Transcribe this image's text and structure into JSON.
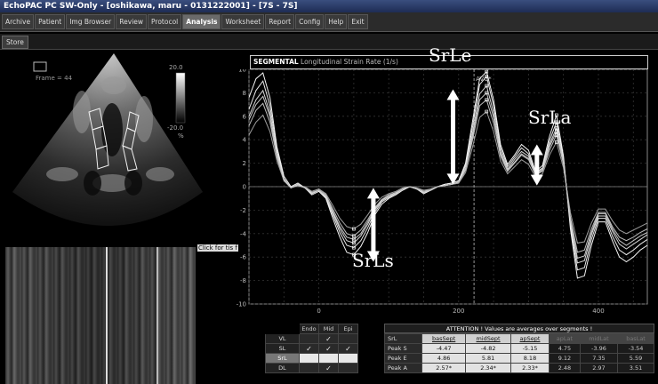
{
  "window": {
    "title": "EchoPAC PC SW-Only - [oshikawa, maru - 0131222001] - [7S - 7S]"
  },
  "menu": {
    "items": [
      {
        "label": "Archive",
        "active": false
      },
      {
        "label": "Patient",
        "active": false
      },
      {
        "label": "Img Browser",
        "active": false
      },
      {
        "label": "Review",
        "active": false
      },
      {
        "label": "Protocol",
        "active": false
      },
      {
        "label": "Analysis",
        "active": true
      },
      {
        "label": "Worksheet",
        "active": false
      },
      {
        "label": "Report",
        "active": false
      },
      {
        "label": "Config",
        "active": false
      },
      {
        "label": "Help",
        "active": false
      },
      {
        "label": "Exit",
        "active": false
      }
    ]
  },
  "toolbar": {
    "store_label": "Store"
  },
  "echo": {
    "frame_label": "Frame = 44",
    "scale_top": "20.0",
    "scale_bottom": "-20.0",
    "scale_unit": "%"
  },
  "mmode": {
    "click_label": "Click for tis f"
  },
  "chart_header": {
    "title_main": "SEGMENTAL",
    "title_sub": " Longitudinal Strain Rate (1/s)"
  },
  "annotations": {
    "srle": "SrLe",
    "srls": "SrLs",
    "srla": "SrLa",
    "avc": "AVC*"
  },
  "chart_data": {
    "type": "line",
    "title": "Longitudinal Strain Rate (1/s)",
    "xlabel": "",
    "ylabel": "",
    "xlim": [
      -100,
      470
    ],
    "ylim": [
      -10,
      10
    ],
    "xticks": [
      0,
      200,
      400
    ],
    "yticks": [
      10,
      8,
      6,
      4,
      2,
      0,
      -2,
      -4,
      -6,
      -8,
      -10
    ],
    "avc_x": 222,
    "grid": true,
    "x": [
      -100,
      -90,
      -80,
      -70,
      -60,
      -50,
      -40,
      -30,
      -20,
      -10,
      0,
      10,
      20,
      30,
      40,
      50,
      60,
      70,
      80,
      90,
      100,
      110,
      120,
      130,
      140,
      150,
      160,
      170,
      180,
      190,
      200,
      210,
      220,
      230,
      240,
      250,
      260,
      270,
      280,
      290,
      300,
      310,
      320,
      330,
      340,
      350,
      360,
      370,
      380,
      390,
      400,
      410,
      420,
      430,
      440,
      450,
      460,
      470
    ],
    "series": [
      {
        "values": [
          6.6,
          8.2,
          9.0,
          6.9,
          3.1,
          0.7,
          -0.1,
          0.2,
          -0.1,
          -0.6,
          -0.3,
          -0.9,
          -2.4,
          -3.9,
          -5.0,
          -5.2,
          -4.6,
          -3.5,
          -2.2,
          -1.3,
          -0.9,
          -0.6,
          -0.2,
          0.0,
          -0.2,
          -0.5,
          -0.3,
          0.0,
          0.2,
          0.3,
          0.5,
          1.8,
          5.1,
          8.7,
          9.4,
          6.9,
          3.3,
          1.7,
          2.5,
          3.3,
          2.8,
          1.2,
          1.6,
          3.9,
          5.5,
          2.4,
          -3.3,
          -7.1,
          -6.9,
          -4.5,
          -2.7,
          -2.7,
          -4.2,
          -5.4,
          -5.8,
          -5.4,
          -4.9,
          -4.5
        ]
      },
      {
        "values": [
          5.2,
          6.5,
          7.1,
          5.5,
          2.5,
          0.5,
          -0.1,
          0.1,
          -0.1,
          -0.4,
          -0.2,
          -0.7,
          -1.9,
          -3.1,
          -4.0,
          -4.2,
          -3.7,
          -2.8,
          -1.8,
          -1.1,
          -0.7,
          -0.5,
          -0.2,
          0.0,
          -0.1,
          -0.4,
          -0.2,
          0.0,
          0.1,
          0.2,
          0.3,
          1.4,
          4.0,
          6.9,
          7.4,
          5.4,
          2.6,
          1.3,
          2.0,
          2.7,
          2.3,
          1.0,
          1.3,
          3.1,
          4.4,
          1.9,
          -2.6,
          -5.6,
          -5.4,
          -3.6,
          -2.2,
          -2.2,
          -3.4,
          -4.3,
          -4.6,
          -4.3,
          -3.9,
          -3.6
        ]
      },
      {
        "values": [
          7.6,
          9.2,
          9.7,
          7.6,
          3.4,
          0.9,
          0.0,
          0.3,
          -0.1,
          -0.7,
          -0.4,
          -1.0,
          -2.7,
          -4.3,
          -5.6,
          -5.8,
          -5.1,
          -3.9,
          -2.4,
          -1.5,
          -1.0,
          -0.7,
          -0.3,
          0.0,
          -0.2,
          -0.6,
          -0.3,
          0.0,
          0.2,
          0.3,
          0.5,
          2.0,
          5.6,
          9.2,
          9.8,
          7.4,
          3.6,
          1.9,
          2.7,
          3.6,
          3.1,
          1.3,
          1.8,
          4.3,
          6.1,
          2.6,
          -3.6,
          -7.8,
          -7.6,
          -5.0,
          -3.0,
          -3.0,
          -4.6,
          -6.0,
          -6.4,
          -6.0,
          -5.4,
          -5.0
        ]
      },
      {
        "values": [
          4.4,
          5.5,
          6.1,
          4.7,
          2.2,
          0.5,
          -0.1,
          0.1,
          0.0,
          -0.4,
          -0.2,
          -0.6,
          -1.6,
          -2.7,
          -3.4,
          -3.6,
          -3.2,
          -2.4,
          -1.5,
          -0.9,
          -0.6,
          -0.4,
          -0.1,
          0.0,
          -0.1,
          -0.3,
          -0.2,
          0.0,
          0.1,
          0.2,
          0.3,
          1.2,
          3.4,
          5.9,
          6.4,
          4.7,
          2.2,
          1.1,
          1.7,
          2.3,
          1.9,
          0.8,
          1.1,
          2.7,
          3.8,
          1.6,
          -2.2,
          -4.8,
          -4.7,
          -3.1,
          -1.9,
          -1.9,
          -2.9,
          -3.7,
          -4.0,
          -3.7,
          -3.4,
          -3.1
        ]
      },
      {
        "values": [
          6.0,
          7.4,
          8.2,
          6.3,
          2.8,
          0.6,
          -0.1,
          0.2,
          -0.1,
          -0.5,
          -0.3,
          -0.8,
          -2.2,
          -3.6,
          -4.6,
          -4.8,
          -4.2,
          -3.2,
          -2.0,
          -1.2,
          -0.8,
          -0.6,
          -0.2,
          0.0,
          -0.2,
          -0.5,
          -0.3,
          0.0,
          0.1,
          0.2,
          0.4,
          1.6,
          4.6,
          7.9,
          8.6,
          6.3,
          3.0,
          1.5,
          2.3,
          3.0,
          2.6,
          1.1,
          1.5,
          3.6,
          5.0,
          2.2,
          -3.0,
          -6.5,
          -6.3,
          -4.1,
          -2.5,
          -2.5,
          -3.8,
          -4.9,
          -5.3,
          -4.9,
          -4.5,
          -4.1
        ]
      },
      {
        "values": [
          5.7,
          7.0,
          7.7,
          6.0,
          2.6,
          0.6,
          -0.1,
          0.1,
          -0.1,
          -0.5,
          -0.3,
          -0.8,
          -2.1,
          -3.4,
          -4.3,
          -4.5,
          -4.0,
          -3.0,
          -1.9,
          -1.1,
          -0.8,
          -0.5,
          -0.2,
          0.0,
          -0.2,
          -0.4,
          -0.3,
          0.0,
          0.1,
          0.2,
          0.4,
          1.5,
          4.3,
          7.4,
          8.0,
          5.9,
          2.8,
          1.4,
          2.1,
          2.8,
          2.4,
          1.0,
          1.4,
          3.4,
          4.7,
          2.1,
          -2.8,
          -6.1,
          -5.9,
          -3.9,
          -2.3,
          -2.3,
          -3.6,
          -4.6,
          -5.0,
          -4.6,
          -4.2,
          -3.9
        ]
      }
    ]
  },
  "segment_table": {
    "headers": [
      "Endo",
      "Mid",
      "Epi"
    ],
    "rows": [
      {
        "name": "VL",
        "cells": [
          "",
          "✓",
          ""
        ],
        "highlight": false
      },
      {
        "name": "SL",
        "cells": [
          "✓",
          "✓",
          "✓"
        ],
        "highlight": false
      },
      {
        "name": "SrL",
        "cells": [
          "",
          "",
          ""
        ],
        "highlight": true
      },
      {
        "name": "DL",
        "cells": [
          "",
          "✓",
          ""
        ],
        "highlight": false
      }
    ]
  },
  "results": {
    "attention": "ATTENTION ! Values are averages over segments !",
    "corner": "SrL",
    "columns": [
      "basSept",
      "midSept",
      "apSept",
      "apLat",
      "midLat",
      "basLat"
    ],
    "rows": [
      {
        "label": "Peak S",
        "values": [
          "-4.47",
          "-4.82",
          "-5.15",
          "4.75",
          "-3.96",
          "-3.54"
        ]
      },
      {
        "label": "Peak E",
        "values": [
          "4.86",
          "5.81",
          "8.18",
          "9.12",
          "7.35",
          "5.59"
        ]
      },
      {
        "label": "Peak A",
        "values": [
          "2.57*",
          "2.34*",
          "2.33*",
          "2.48",
          "2.97",
          "3.51"
        ]
      }
    ]
  }
}
